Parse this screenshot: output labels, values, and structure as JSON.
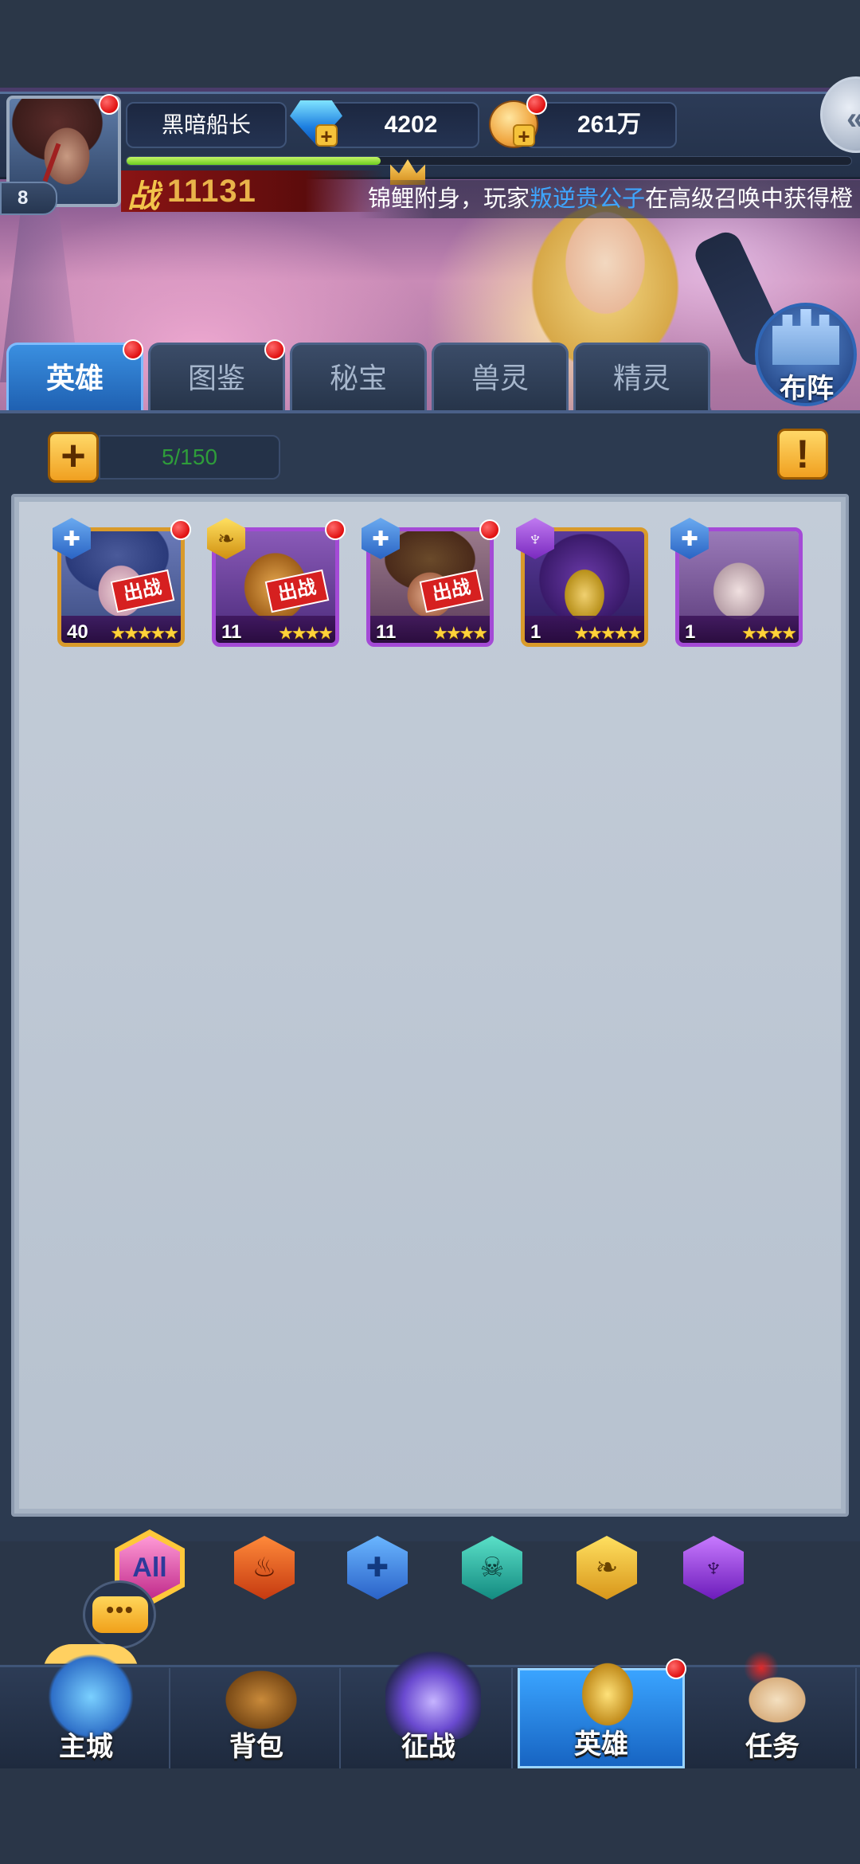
{
  "player": {
    "name": "黑暗船长",
    "level": "8",
    "gems": "4202",
    "gold": "261万",
    "power_label": "战",
    "power_value": "11131",
    "exp_fraction": 0.35
  },
  "ticker": {
    "prefix": "锦鲤附身，玩家",
    "player_name": "叛逆贵公子",
    "suffix": "在高级召唤中获得橙"
  },
  "tabs": [
    "英雄",
    "图鉴",
    "秘宝",
    "兽灵",
    "精灵"
  ],
  "formation_button": "布阵",
  "hero_list": {
    "count_text": "5/150",
    "add_symbol": "+",
    "info_symbol": "!"
  },
  "heroes": [
    {
      "level": "40",
      "stars": "★★★★★",
      "deployed_label": "出战",
      "frame": "gold"
    },
    {
      "level": "11",
      "stars": "★★★★",
      "deployed_label": "出战",
      "frame": "purple"
    },
    {
      "level": "11",
      "stars": "★★★★",
      "deployed_label": "出战",
      "frame": "purple"
    },
    {
      "level": "1",
      "stars": "★★★★★",
      "deployed_label": "",
      "frame": "gold"
    },
    {
      "level": "1",
      "stars": "★★★★",
      "deployed_label": "",
      "frame": "purple"
    }
  ],
  "filters": {
    "all_label": "All"
  },
  "chat_icon_text": "•••",
  "bottom_nav": [
    "主城",
    "背包",
    "征战",
    "英雄",
    "任务"
  ],
  "colors": {
    "accent_blue": "#1e5fb0",
    "notify_red": "#e01010",
    "gold": "#f0a020",
    "count_green": "#2e9d3a"
  }
}
